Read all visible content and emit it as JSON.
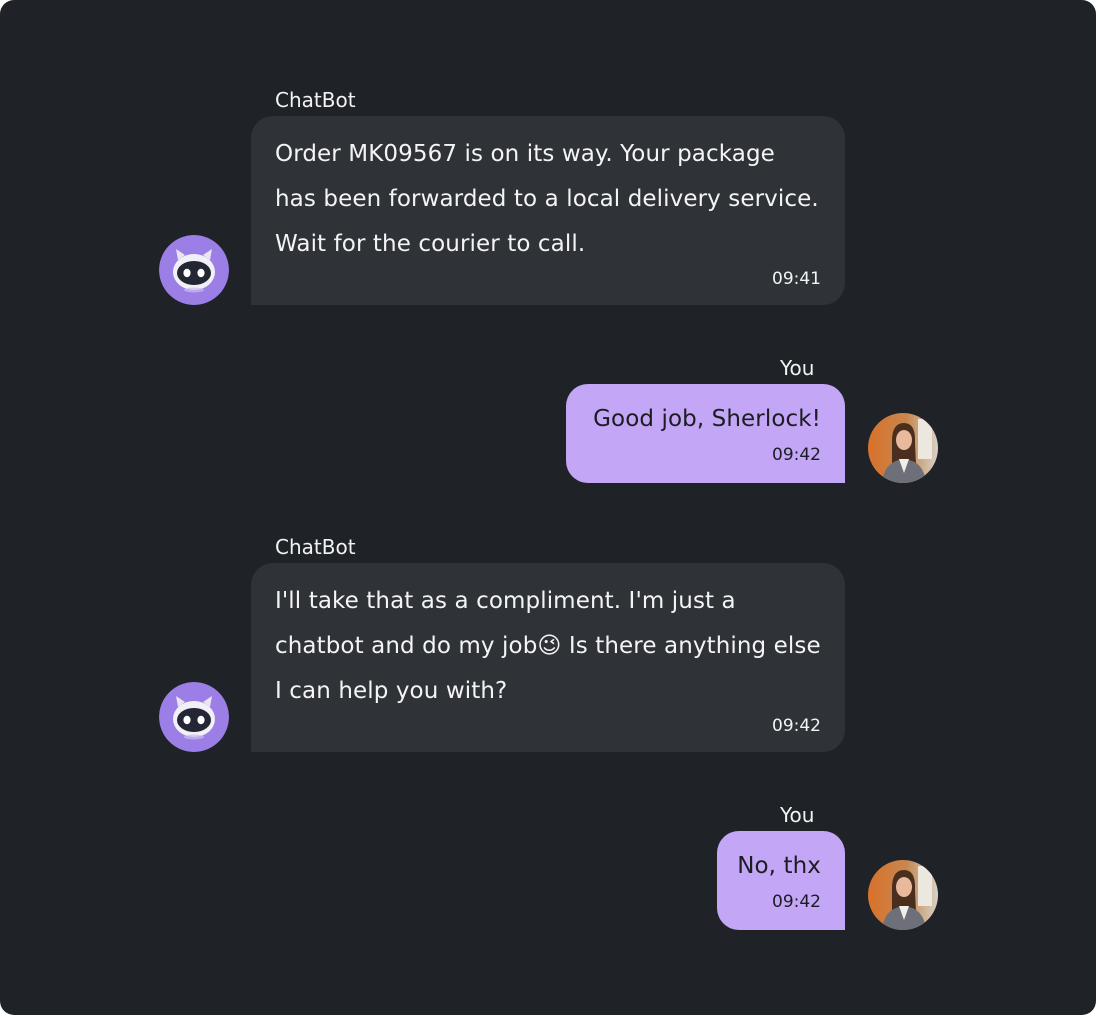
{
  "chat": {
    "messages": [
      {
        "sender": "ChatBot",
        "text": "Order  MK09567 is on its way. Your package has been forwarded to a local delivery service. Wait for the courier to call.",
        "time": "09:41"
      },
      {
        "sender": "You",
        "text": "Good job, Sherlock!",
        "time": "09:42"
      },
      {
        "sender": "ChatBot",
        "text": "I'll take that as a compliment. I'm just a chatbot and do my job😉 Is there anything else I can help you with?",
        "time": "09:42"
      },
      {
        "sender": "You",
        "text": "No, thx",
        "time": "09:42"
      }
    ]
  },
  "icons": {
    "bot_avatar": "robot-icon",
    "user_avatar": "user-photo"
  },
  "colors": {
    "background": "#1f2227",
    "bot_bubble": "#2f3236",
    "user_bubble": "#c3a6f5",
    "bot_avatar_bg": "#9b7ee6"
  }
}
